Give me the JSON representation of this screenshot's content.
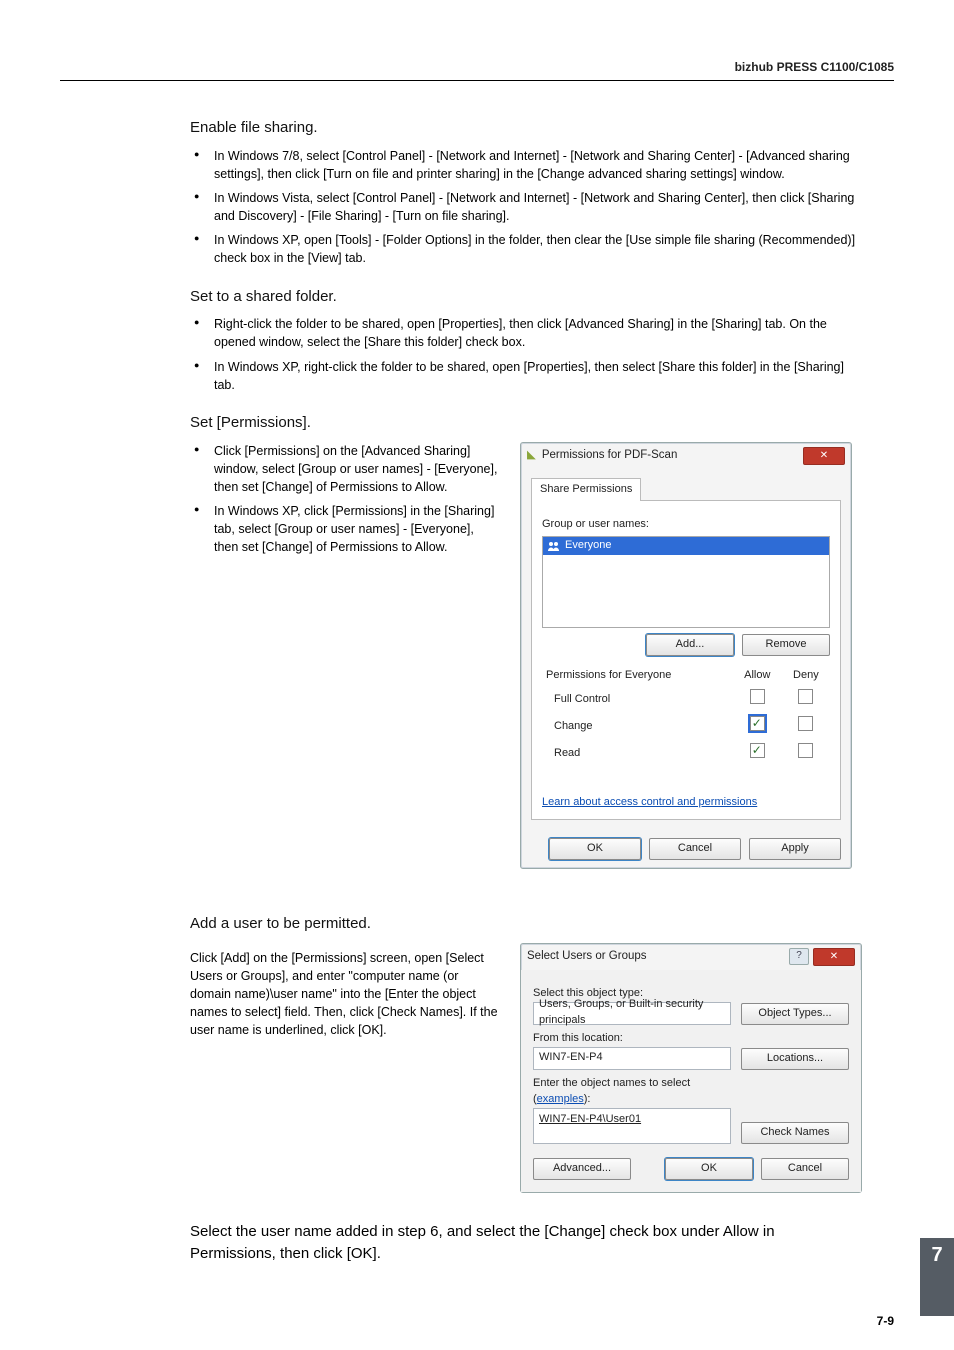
{
  "header": {
    "title": "bizhub PRESS C1100/C1085"
  },
  "steps": {
    "s3": {
      "title": "Enable file sharing.",
      "items": [
        "In Windows 7/8, select [Control Panel] - [Network and Internet] - [Network and Sharing Center] - [Advanced sharing settings], then click [Turn on file and printer sharing] in the [Change advanced sharing settings] window.",
        "In Windows Vista, select [Control Panel] - [Network and Internet] - [Network and Sharing Center], then click [Sharing and Discovery] - [File Sharing] - [Turn on file sharing].",
        "In Windows XP, open [Tools] - [Folder Options] in the folder, then clear the [Use simple file sharing (Recommended)] check box in the [View] tab."
      ]
    },
    "s4": {
      "title": "Set to a shared folder.",
      "items": [
        "Right-click the folder to be shared, open [Properties], then click [Advanced Sharing] in the [Sharing] tab. On the opened window, select the [Share this folder] check box.",
        "In Windows XP, right-click the folder to be shared, open [Properties], then select [Share this folder] in the [Sharing] tab."
      ]
    },
    "s5": {
      "title": "Set [Permissions].",
      "items": [
        "Click [Permissions] on the [Advanced Sharing] window, select [Group or user names] - [Everyone], then set [Change] of Permissions to Allow.",
        "In Windows XP, click [Permissions] in the [Sharing] tab, select [Group or user names] - [Everyone], then set [Change] of Permissions to Allow."
      ]
    },
    "s6": {
      "title": "Add a user to be permitted.",
      "text": "Click [Add] on the [Permissions] screen, open [Select Users or Groups], and enter \"computer name (or domain name)\\user name\" into the [Enter the object names to select] field. Then, click [Check Names]. If the user name is underlined, click [OK]."
    },
    "s7": {
      "text": "Select the user name added in step 6, and select the [Change] check box under Allow in Permissions, then click [OK]."
    }
  },
  "dlg_perm": {
    "title": "Permissions for PDF-Scan",
    "tab": "Share Permissions",
    "group_label": "Group or user names:",
    "group_selected": "Everyone",
    "add": "Add...",
    "remove": "Remove",
    "perm_for": "Permissions for Everyone",
    "allow": "Allow",
    "deny": "Deny",
    "rows": [
      "Full Control",
      "Change",
      "Read"
    ],
    "learn": "Learn about access control and permissions",
    "ok": "OK",
    "cancel": "Cancel",
    "apply": "Apply"
  },
  "dlg_sel": {
    "title": "Select Users or Groups",
    "obj_type_label": "Select this object type:",
    "obj_type_value": "Users, Groups, or Built-in security principals",
    "obj_types_btn": "Object Types...",
    "loc_label": "From this location:",
    "loc_value": "WIN7-EN-P4",
    "locations_btn": "Locations...",
    "enter_label": "Enter the object names to select",
    "examples": "examples",
    "enter_value": "WIN7-EN-P4\\User01",
    "check_names": "Check Names",
    "advanced": "Advanced...",
    "ok": "OK",
    "cancel": "Cancel"
  },
  "footer": {
    "chapter": "7",
    "page": "7-9"
  }
}
